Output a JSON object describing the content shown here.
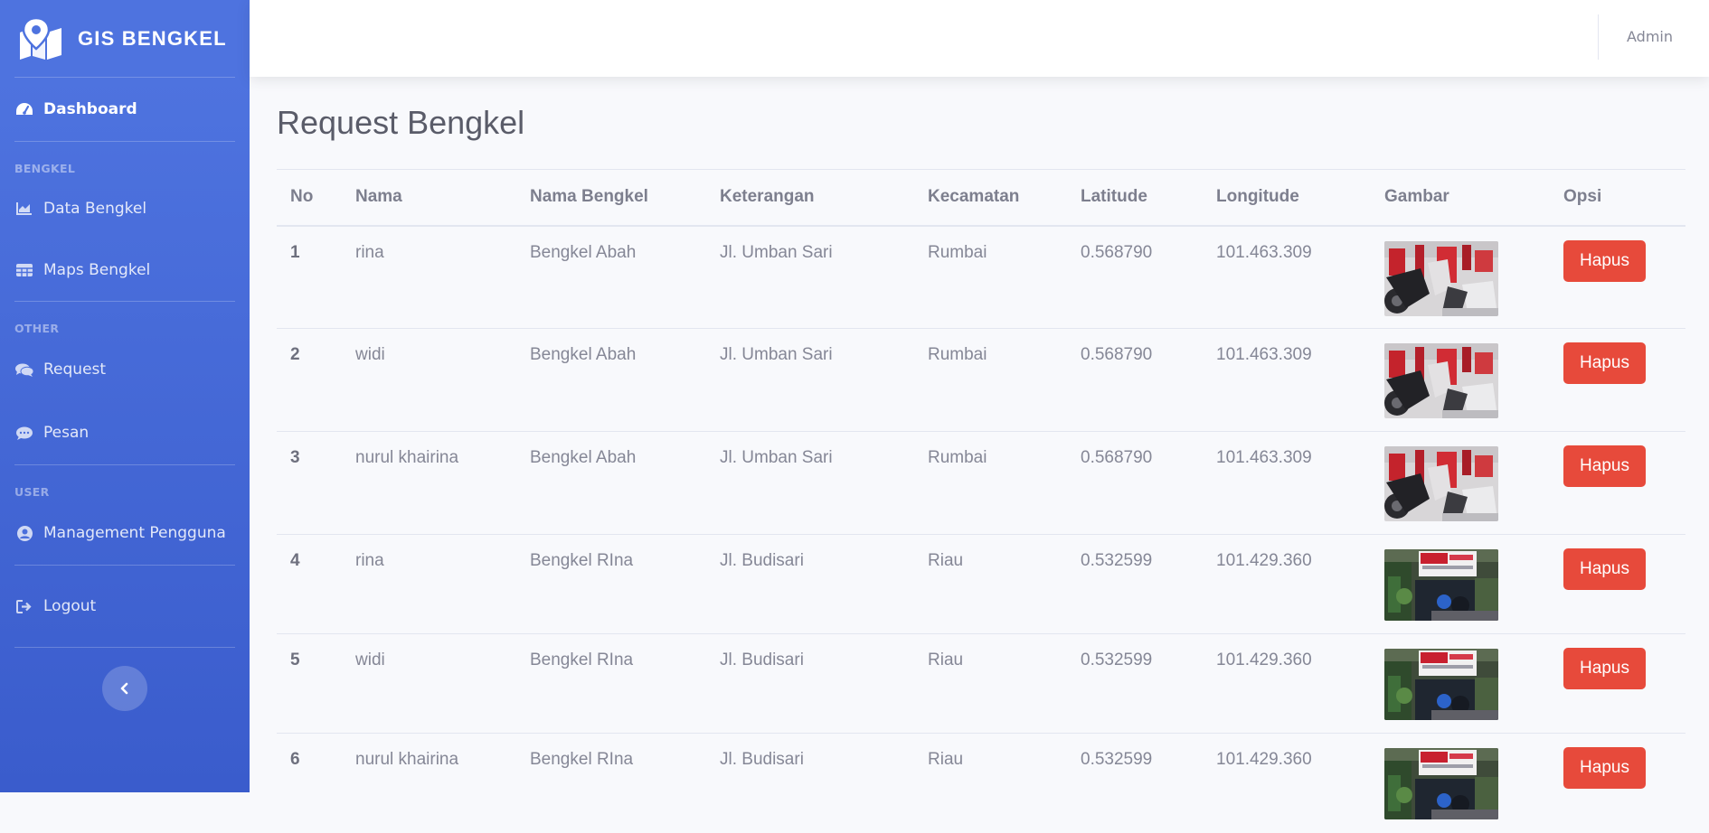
{
  "brand": {
    "title": "GIS BENGKEL",
    "icon": "map-marker-icon"
  },
  "sidebar": {
    "dashboard": {
      "label": "Dashboard",
      "icon": "tachometer-icon"
    },
    "heading_bengkel": "BENGKEL",
    "data_bengkel": {
      "label": "Data Bengkel",
      "icon": "chart-area-icon"
    },
    "maps_bengkel": {
      "label": "Maps Bengkel",
      "icon": "table-icon"
    },
    "heading_other": "OTHER",
    "request": {
      "label": "Request",
      "icon": "comments-icon"
    },
    "pesan": {
      "label": "Pesan",
      "icon": "comment-dots-icon"
    },
    "heading_user": "USER",
    "management": {
      "label": "Management Pengguna",
      "icon": "user-circle-icon"
    },
    "logout": {
      "label": "Logout",
      "icon": "sign-out-icon"
    },
    "toggle_icon": "chevron-left-icon"
  },
  "topbar": {
    "user": "Admin"
  },
  "page": {
    "title": "Request Bengkel"
  },
  "table": {
    "headers": [
      "No",
      "Nama",
      "Nama Bengkel",
      "Keterangan",
      "Kecamatan",
      "Latitude",
      "Longitude",
      "Gambar",
      "Opsi"
    ],
    "rows": [
      {
        "no": "1",
        "nama": "rina",
        "bengkel": "Bengkel Abah",
        "keterangan": "Jl. Umban Sari",
        "kecamatan": "Rumbai",
        "lat": "0.568790",
        "lng": "101.463.309",
        "action": "Hapus"
      },
      {
        "no": "2",
        "nama": "widi",
        "bengkel": "Bengkel Abah",
        "keterangan": "Jl. Umban Sari",
        "kecamatan": "Rumbai",
        "lat": "0.568790",
        "lng": "101.463.309",
        "action": "Hapus"
      },
      {
        "no": "3",
        "nama": "nurul khairina",
        "bengkel": "Bengkel Abah",
        "keterangan": "Jl. Umban Sari",
        "kecamatan": "Rumbai",
        "lat": "0.568790",
        "lng": "101.463.309",
        "action": "Hapus"
      },
      {
        "no": "4",
        "nama": "rina",
        "bengkel": "Bengkel RIna",
        "keterangan": "Jl. Budisari",
        "kecamatan": "Riau",
        "lat": "0.532599",
        "lng": "101.429.360",
        "action": "Hapus"
      },
      {
        "no": "5",
        "nama": "widi",
        "bengkel": "Bengkel RIna",
        "keterangan": "Jl. Budisari",
        "kecamatan": "Riau",
        "lat": "0.532599",
        "lng": "101.429.360",
        "action": "Hapus"
      },
      {
        "no": "6",
        "nama": "nurul khairina",
        "bengkel": "Bengkel RIna",
        "keterangan": "Jl. Budisari",
        "kecamatan": "Riau",
        "lat": "0.532599",
        "lng": "101.429.360",
        "action": "Hapus"
      }
    ]
  },
  "colors": {
    "sidebar": "#4e73df",
    "danger": "#e74a3b",
    "background": "#f8f9fc"
  }
}
